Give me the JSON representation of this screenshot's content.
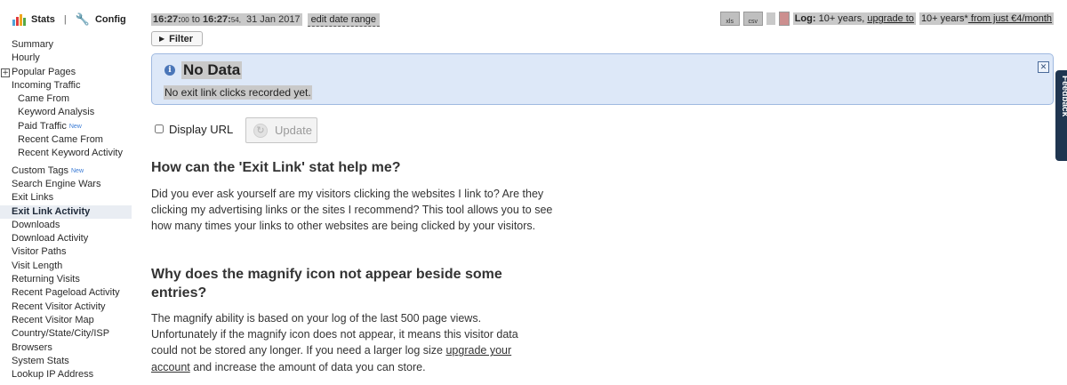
{
  "header": {
    "stats_label": "Stats",
    "separator": "|",
    "config_label": "Config"
  },
  "sidebar": {
    "items": [
      {
        "label": "Summary",
        "indent": false
      },
      {
        "label": "Hourly",
        "indent": false
      },
      {
        "label": "Popular Pages",
        "indent": false,
        "expand": "+"
      },
      {
        "label": "Incoming Traffic",
        "indent": false
      },
      {
        "label": "Came From",
        "indent": true
      },
      {
        "label": "Keyword Analysis",
        "indent": true
      },
      {
        "label": "Paid Traffic",
        "indent": true,
        "badge": "New"
      },
      {
        "label": "Recent Came From",
        "indent": true
      },
      {
        "label": "Recent Keyword Activity",
        "indent": true
      },
      {
        "label": "Custom Tags",
        "indent": false,
        "badge": "New",
        "gap": true
      },
      {
        "label": "Search Engine Wars",
        "indent": false
      },
      {
        "label": "Exit Links",
        "indent": false
      },
      {
        "label": "Exit Link Activity",
        "indent": false,
        "active": true
      },
      {
        "label": "Downloads",
        "indent": false
      },
      {
        "label": "Download Activity",
        "indent": false
      },
      {
        "label": "Visitor Paths",
        "indent": false
      },
      {
        "label": "Visit Length",
        "indent": false
      },
      {
        "label": "Returning Visits",
        "indent": false
      },
      {
        "label": "Recent Pageload Activity",
        "indent": false
      },
      {
        "label": "Recent Visitor Activity",
        "indent": false
      },
      {
        "label": "Recent Visitor Map",
        "indent": false
      },
      {
        "label": "Country/State/City/ISP",
        "indent": false
      },
      {
        "label": "Browsers",
        "indent": false
      },
      {
        "label": "System Stats",
        "indent": false
      },
      {
        "label": "Lookup IP Address",
        "indent": false
      }
    ]
  },
  "daterange": {
    "start_main": "16:27:",
    "start_sec": "00",
    "to": "to",
    "end_main": "16:27:",
    "end_sec": "54,",
    "date": "31 Jan 2017",
    "edit_label": "edit date range"
  },
  "export": {
    "xls_label": "xls",
    "csv_label": "csv"
  },
  "log": {
    "label": "Log:",
    "value": "10+ years,",
    "upgrade_link": "upgrade to",
    "upgrade_value": "10+ years*",
    "price_link": " from just €4/month"
  },
  "filter": {
    "label": "Filter"
  },
  "info": {
    "title": "No Data",
    "message": "No exit link clicks recorded yet."
  },
  "form": {
    "display_url_label": "Display URL",
    "display_url_checked": false,
    "update_label": "Update"
  },
  "help": {
    "q1": "How can the 'Exit Link' stat help me?",
    "a1": "Did you ever ask yourself are my visitors clicking the websites I link to? Are they clicking my advertising links or the sites I recommend? This tool allows you to see how many times your links to other websites are being clicked by your visitors.",
    "q2": "Why does the magnify icon not appear beside some entries?",
    "a2_text": "The magnify ability is based on your log of the last 500 page views. Unfortunately if the magnify icon does not appear, it means this visitor data could not be stored any longer. If you need a larger log size",
    "a2_link": "upgrade your account",
    "a2_tail": "and increase the amount of data you can store."
  },
  "feedback": {
    "label": "Feedback"
  },
  "colors": {
    "info_bg": "#dde8f8",
    "info_border": "#9fb9e0",
    "feedback_bg": "#1f3550",
    "logo_bars": [
      "#4fa3d9",
      "#e23b3b",
      "#f0a81f",
      "#55a846"
    ]
  }
}
